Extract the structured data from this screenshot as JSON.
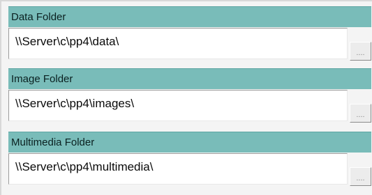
{
  "folders": [
    {
      "label": "Data Folder",
      "path": "\\\\Server\\c\\pp4\\data\\",
      "browse_label": "...."
    },
    {
      "label": "Image Folder",
      "path": "\\\\Server\\c\\pp4\\images\\",
      "browse_label": "...."
    },
    {
      "label": "Multimedia Folder",
      "path": "\\\\Server\\c\\pp4\\multimedia\\",
      "browse_label": "...."
    }
  ],
  "colors": {
    "header_background": "#79bcb9",
    "panel_background": "#f4f4f4",
    "field_background": "#ffffff"
  }
}
